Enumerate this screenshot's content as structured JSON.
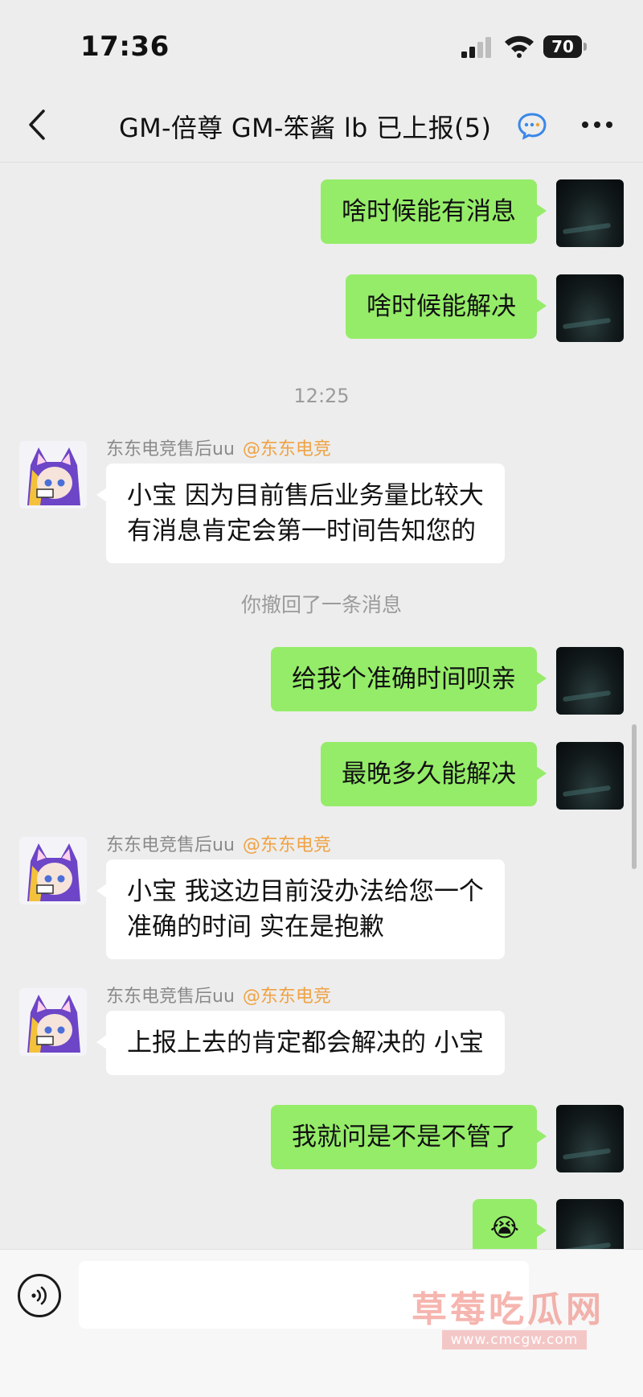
{
  "status_bar": {
    "time": "17:36",
    "battery": "70"
  },
  "header": {
    "title": "GM-倍尊 GM-笨酱 lb 已上报(5)"
  },
  "messages": {
    "m1": "啥时候能有消息",
    "m2": "啥时候能解决",
    "time1": "12:25",
    "sender_name": "东东电竞售后uu",
    "sender_tag": "@东东电竞",
    "m3_line1": "小宝 因为目前售后业务量比较大",
    "m3_line2": "有消息肯定会第一时间告知您的",
    "recall_note": "你撤回了一条消息",
    "m4": "给我个准确时间呗亲",
    "m5": "最晚多久能解决",
    "m6_line1": "小宝 我这边目前没办法给您一个",
    "m6_line2": "准确的时间 实在是抱歉",
    "m7": "上报上去的肯定都会解决的 小宝",
    "m8": "我就问是不是不管了",
    "m9_emoji": "😭"
  },
  "input_bar": {
    "value": "",
    "watermark": "草莓吃瓜网",
    "watermark_url": "www.cmcgw.com"
  },
  "colors": {
    "sent_bubble": "#95ec69",
    "received_bubble": "#ffffff",
    "background": "#ededed",
    "tag": "#f0a243"
  }
}
